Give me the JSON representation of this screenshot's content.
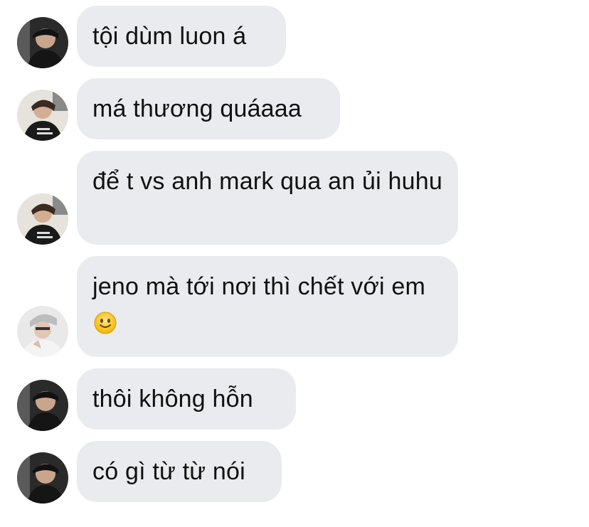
{
  "messages": [
    {
      "text": "tội dùm luon á",
      "avatar": "dark-cap-avatar"
    },
    {
      "text": "má thương quáaaa",
      "avatar": "dark-hoodie-avatar"
    },
    {
      "text": "để t vs anh mark qua an ủi huhu",
      "avatar": "dark-hoodie-avatar"
    },
    {
      "text": "jeno mà tới nơi thì  chết với em",
      "avatar": "light-avatar",
      "emoji": "slightly-smiling-face"
    },
    {
      "text": "thôi không hỗn",
      "avatar": "dark-cap-avatar"
    },
    {
      "text": "có gì từ từ nói",
      "avatar": "dark-cap-avatar"
    }
  ],
  "colors": {
    "bubble": "#e9ebee",
    "text": "#111111",
    "background": "#ffffff"
  }
}
